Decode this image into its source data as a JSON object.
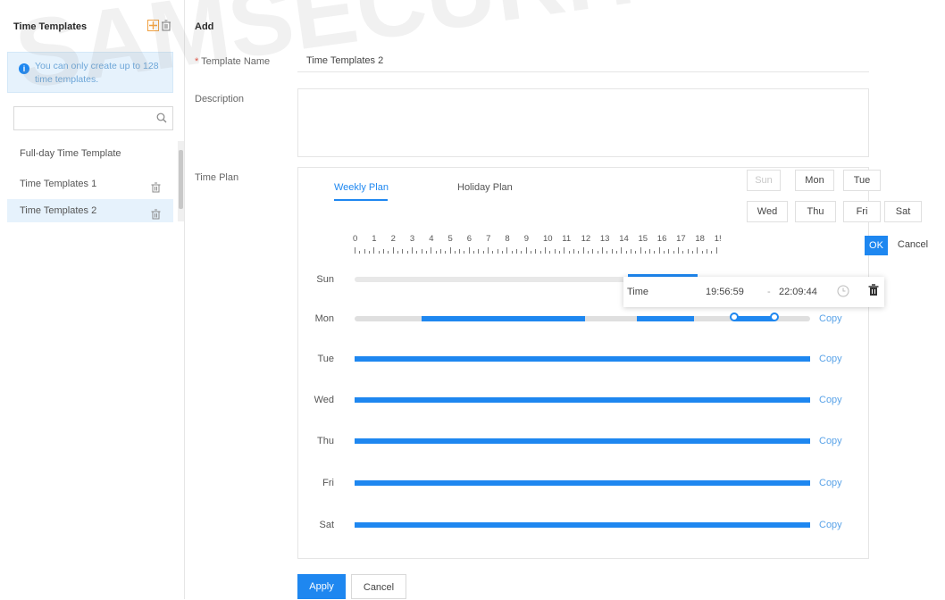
{
  "sidebar": {
    "title": "Time Templates",
    "info": "You can only create up to 128 time templates.",
    "search_placeholder": "",
    "templates": [
      {
        "label": "Full-day Time Template"
      },
      {
        "label": "Time Templates 1"
      },
      {
        "label": "Time Templates 2"
      }
    ]
  },
  "form": {
    "title": "Add",
    "required_mark": "*",
    "name_label": "Template Name",
    "name_value": "Time Templates 2",
    "description_label": "Description",
    "description_value": "",
    "plan_label": "Time Plan"
  },
  "plan": {
    "tabs": [
      {
        "label": "Weekly Plan"
      },
      {
        "label": "Holiday Plan"
      }
    ],
    "ruler": [
      "0",
      "1",
      "2",
      "3",
      "4",
      "5",
      "6",
      "7",
      "8",
      "9",
      "10",
      "11",
      "12",
      "13",
      "14",
      "15",
      "16",
      "17",
      "18",
      "1!"
    ],
    "days": [
      {
        "label": "Sun",
        "copy": ""
      },
      {
        "label": "Mon",
        "copy": "Copy"
      },
      {
        "label": "Tue",
        "copy": "Copy"
      },
      {
        "label": "Wed",
        "copy": "Copy"
      },
      {
        "label": "Thu",
        "copy": "Copy"
      },
      {
        "label": "Fri",
        "copy": "Copy"
      },
      {
        "label": "Sat",
        "copy": "Copy"
      }
    ]
  },
  "copy_panel": {
    "days": [
      "Sun",
      "Mon",
      "Tue",
      "Wed",
      "Thu",
      "Fri",
      "Sat"
    ],
    "ok": "OK",
    "cancel": "Cancel"
  },
  "time_popup": {
    "label": "Time",
    "start": "19:56:59",
    "separator": "-",
    "end": "22:09:44"
  },
  "footer": {
    "apply": "Apply",
    "cancel": "Cancel"
  },
  "watermark": "SAMSECURITY",
  "colors": {
    "accent": "#1e87f0",
    "selected_bg": "#e6f2fc"
  }
}
